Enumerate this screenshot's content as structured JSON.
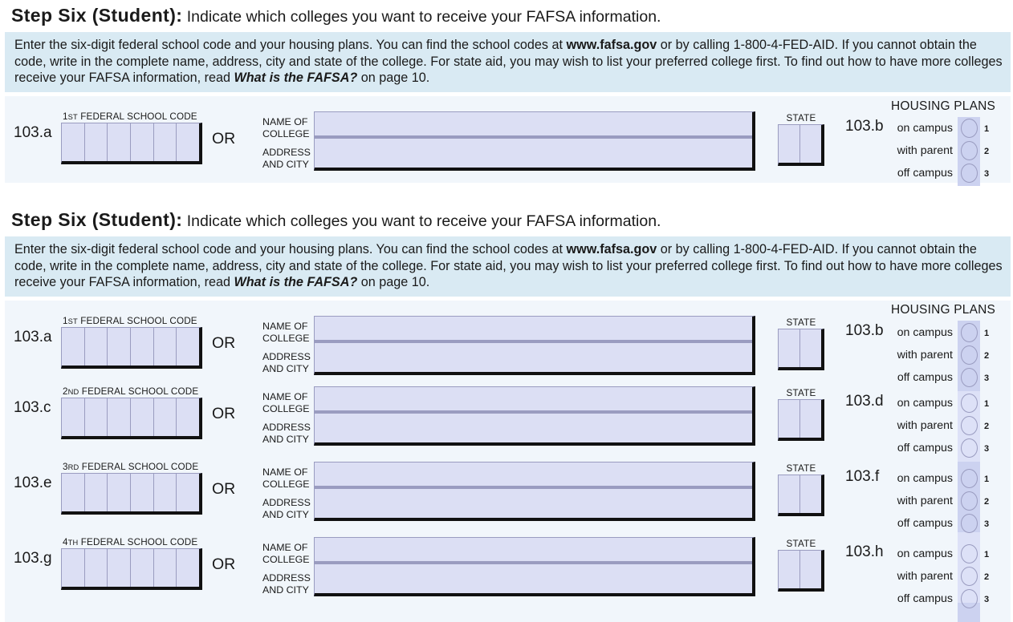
{
  "document": {
    "form_name": "FAFSA",
    "step_heading_bold": "Step Six (Student):",
    "step_heading_rest": " Indicate which colleges you want to receive your FAFSA information."
  },
  "instructions": {
    "part1": "Enter the six-digit federal school code and your housing plans. You can find the school codes at ",
    "website": "www.fafsa.gov",
    "part2": " or by calling 1-800-4-FED-AID. If you cannot obtain the code, write in the complete name, address, city and state of the college. For state aid, you may wish to list your preferred college first. To find out how to have more colleges receive your FAFSA information, read ",
    "reference": "What is the FAFSA?",
    "part3": " on page 10."
  },
  "labels": {
    "or": "OR",
    "name_of": "NAME OF",
    "college": "COLLEGE",
    "address": "ADDRESS",
    "and_city": "AND CITY",
    "state": "STATE",
    "housing_plans": "HOUSING PLANS",
    "federal_school_code": " FEDERAL SCHOOL CODE"
  },
  "housing_options": [
    {
      "label": "on campus",
      "number": "1"
    },
    {
      "label": "with parent",
      "number": "2"
    },
    {
      "label": "off campus",
      "number": "3"
    }
  ],
  "sections": [
    {
      "id": "section-one",
      "rows": [
        {
          "question": "103.a",
          "ordinal_num": "1",
          "ordinal_suffix": "ST",
          "code_caption_num": "1",
          "code_caption_suffix": "ST",
          "housing_question": "103.b",
          "code_value": "",
          "name_value": "",
          "address_value": "",
          "state_value": ""
        }
      ]
    },
    {
      "id": "section-two",
      "rows": [
        {
          "question": "103.a",
          "ordinal_num": "1",
          "ordinal_suffix": "ST",
          "code_caption_num": "1",
          "code_caption_suffix": "ST",
          "housing_question": "103.b",
          "code_value": "",
          "name_value": "",
          "address_value": "",
          "state_value": ""
        },
        {
          "question": "103.c",
          "ordinal_num": "2",
          "ordinal_suffix": "ND",
          "code_caption_num": "2",
          "code_caption_suffix": "ND",
          "housing_question": "103.d",
          "code_value": "",
          "name_value": "",
          "address_value": "",
          "state_value": ""
        },
        {
          "question": "103.e",
          "ordinal_num": "3",
          "ordinal_suffix": "RD",
          "code_caption_num": "3",
          "code_caption_suffix": "RD",
          "housing_question": "103.f",
          "code_value": "",
          "name_value": "",
          "address_value": "",
          "state_value": ""
        },
        {
          "question": "103.g",
          "ordinal_num": "4",
          "ordinal_suffix": "TH",
          "code_caption_num": "4",
          "code_caption_suffix": "TH",
          "housing_question": "103.h",
          "code_value": "",
          "name_value": "",
          "address_value": "",
          "state_value": ""
        }
      ]
    }
  ],
  "colors": {
    "instruction_band": "#d9eaf3",
    "panel_background": "#f1f6fb",
    "field_fill": "#dcdff4",
    "field_border": "#9a9cc0",
    "field_shadow": "#111111",
    "housing_strip": "#ccd2f0",
    "housing_strip_light": "#dde1f7"
  }
}
